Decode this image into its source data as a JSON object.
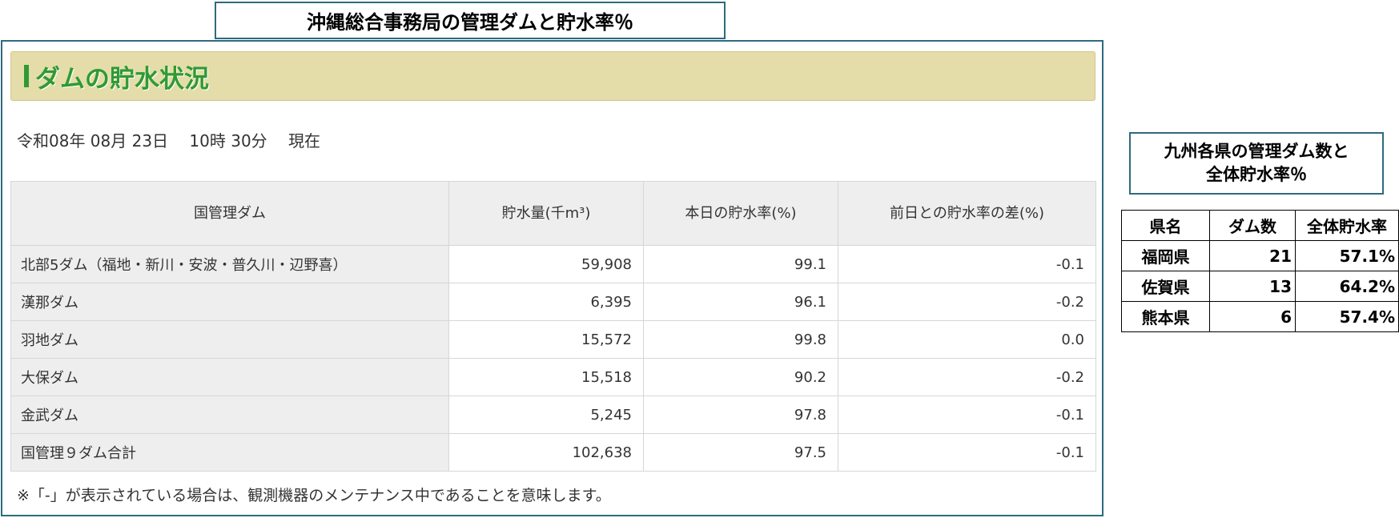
{
  "top_title": "沖縄総合事務局の管理ダムと貯水率％",
  "panel": {
    "heading": "ダムの貯水状況",
    "timestamp": "令和08年 08月 23日　 10時 30分　 現在",
    "table": {
      "headers": [
        "国管理ダム",
        "貯水量(千m³)",
        "本日の貯水率(%)",
        "前日との貯水率の差(%)"
      ],
      "rows": [
        [
          "北部5ダム（福地・新川・安波・普久川・辺野喜）",
          "59,908",
          "99.1",
          "-0.1"
        ],
        [
          "漢那ダム",
          "6,395",
          "96.1",
          "-0.2"
        ],
        [
          "羽地ダム",
          "15,572",
          "99.8",
          "0.0"
        ],
        [
          "大保ダム",
          "15,518",
          "90.2",
          "-0.2"
        ],
        [
          "金武ダム",
          "5,245",
          "97.8",
          "-0.1"
        ],
        [
          "国管理９ダム合計",
          "102,638",
          "97.5",
          "-0.1"
        ]
      ]
    },
    "note": "※「-」が表示されている場合は、観測機器のメンテナンス中であることを意味します。"
  },
  "side": {
    "title_line1": "九州各県の管理ダム数と",
    "title_line2": "全体貯水率％",
    "headers": [
      "県名",
      "ダム数",
      "全体貯水率"
    ],
    "rows": [
      [
        "福岡県",
        "21",
        "57.1%"
      ],
      [
        "佐賀県",
        "13",
        "64.2%"
      ],
      [
        "熊本県",
        "6",
        "57.4%"
      ]
    ]
  },
  "colors": {
    "frame": "#2e6b7d",
    "heading_bg": "#e4ddaa",
    "heading_text": "#2f9a33"
  }
}
